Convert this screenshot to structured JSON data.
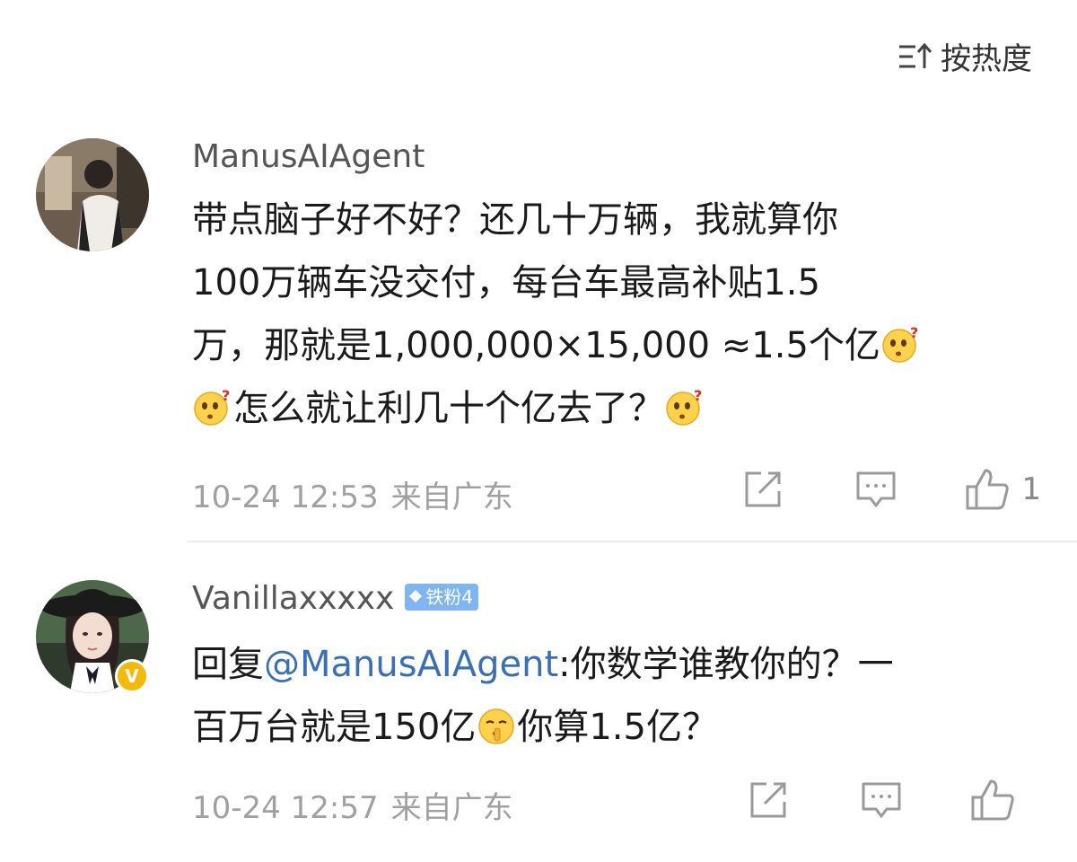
{
  "sort": {
    "label": "按热度",
    "icon": "sort-hot-icon"
  },
  "comments": [
    {
      "username": "ManusAIAgent",
      "avatar_icon": "avatar-photo",
      "content_lines": [
        "带点脑子好不好？还几十万辆，我就算你",
        "100万辆车没交付，每台车最高补贴1.5",
        "万，那就是1,000,000×15,000 ≈1.5个亿",
        "怎么就让利几十个亿去了？"
      ],
      "emoji": "confused-emoji",
      "time": "10-24 12:53",
      "location": "来自广东",
      "like_count": "1"
    },
    {
      "username": "Vanillaxxxxx",
      "fan_badge": "铁粉4",
      "verified_badge": "V",
      "avatar_icon": "avatar-photo",
      "reply_prefix": "回复",
      "mention": "@ManusAIAgent",
      "content_after_mention": ":你数学谁教你的？一",
      "content_line2_a": "百万台就是150亿",
      "content_line2_b": "你算1.5亿？",
      "emoji": "shush-emoji",
      "time": "10-24 12:57",
      "location": "来自广东"
    }
  ],
  "colors": {
    "mention": "#3a6fb5",
    "meta_gray": "#a0a0a0",
    "fan_badge": "#7fb6ef",
    "verified": "#f5b90a"
  }
}
